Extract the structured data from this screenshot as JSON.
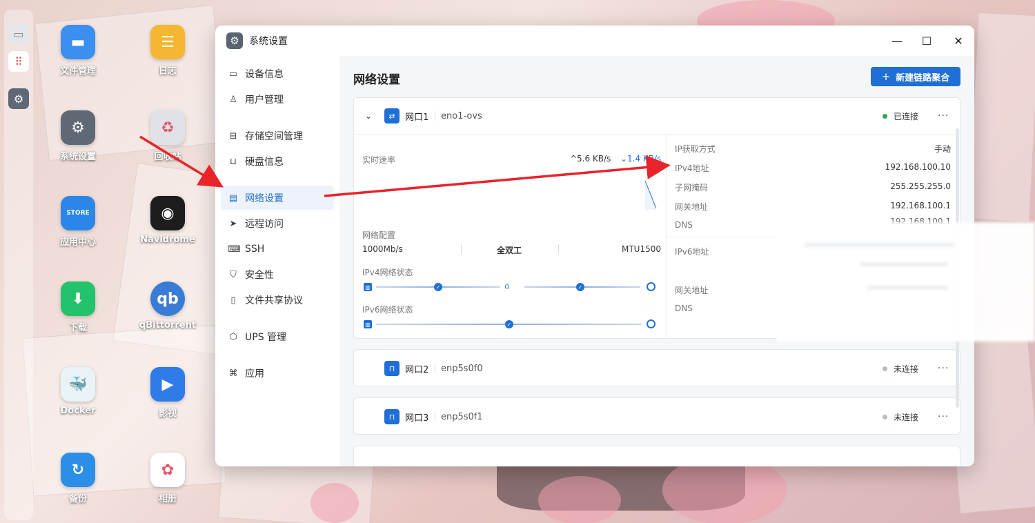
{
  "colors": {
    "accent": "#1f6fd6",
    "connected": "#2fa84f",
    "disconnected": "#b5bcc6",
    "arrow": "#e8232a"
  },
  "desktop": {
    "icons": [
      {
        "label": "文件管理",
        "icon": "folder-icon",
        "color": "#3b8ff0"
      },
      {
        "label": "日志",
        "icon": "log-icon",
        "color": "#f5b731"
      },
      {
        "label": "系统设置",
        "icon": "settings-icon",
        "color": "#5f6875"
      },
      {
        "label": "回收站",
        "icon": "recycle-icon",
        "color": "#dfe3e8"
      },
      {
        "label": "应用中心",
        "icon": "store-icon",
        "color": "#2b86e8"
      },
      {
        "label": "Navidrome",
        "icon": "vinyl-icon",
        "color": "#1d1d1d"
      },
      {
        "label": "下载",
        "icon": "download-icon",
        "color": "#22c36a"
      },
      {
        "label": "qBittorrent",
        "icon": "qbittorrent-icon",
        "color": "#3a7bd5"
      },
      {
        "label": "Docker",
        "icon": "docker-icon",
        "color": "#e9f2f7"
      },
      {
        "label": "影视",
        "icon": "video-icon",
        "color": "#2f7be8"
      },
      {
        "label": "备份",
        "icon": "backup-icon",
        "color": "#2b8fe8"
      },
      {
        "label": "相册",
        "icon": "photos-icon",
        "color": "#ffffff"
      }
    ],
    "store_text": "STORE",
    "qb_text": "qb"
  },
  "window": {
    "title": "系统设置",
    "controls": {
      "minimize": "—",
      "maximize": "☐",
      "close": "✕"
    }
  },
  "sidebar": {
    "items": [
      {
        "label": "设备信息",
        "icon": "device-info-icon",
        "glyph": "▭"
      },
      {
        "label": "用户管理",
        "icon": "user-icon",
        "glyph": "♙"
      },
      {
        "label": "存储空间管理",
        "icon": "storage-icon",
        "glyph": "⊟"
      },
      {
        "label": "硬盘信息",
        "icon": "disk-icon",
        "glyph": "⊔"
      },
      {
        "label": "网络设置",
        "icon": "network-icon",
        "glyph": "▤"
      },
      {
        "label": "远程访问",
        "icon": "remote-access-icon",
        "glyph": "➤"
      },
      {
        "label": "SSH",
        "icon": "ssh-icon",
        "glyph": "⌨"
      },
      {
        "label": "安全性",
        "icon": "shield-icon",
        "glyph": "⛉"
      },
      {
        "label": "文件共享协议",
        "icon": "file-share-icon",
        "glyph": "▯"
      },
      {
        "label": "UPS 管理",
        "icon": "ups-icon",
        "glyph": "⬡"
      },
      {
        "label": "应用",
        "icon": "apps-icon",
        "glyph": "⌘"
      }
    ],
    "active_label": "网络设置"
  },
  "main": {
    "title": "网络设置",
    "new_button": "新建链路聚合",
    "ports": [
      {
        "name": "网口1",
        "device": "eno1-ovs",
        "status": "已连接",
        "expanded": true,
        "speed_label": "实时速率",
        "upload": "5.6 KB/s",
        "download": "1.4 KB/s",
        "config_label": "网络配置",
        "link_speed": "1000Mb/s",
        "duplex": "全双工",
        "mtu": "MTU1500",
        "ipv4_status_label": "IPv4网络状态",
        "ipv6_status_label": "IPv6网络状态",
        "ip_method_label": "IP获取方式",
        "ip_method": "手动",
        "ipv4_label": "IPv4地址",
        "ipv4": "192.168.100.10",
        "mask_label": "子网掩码",
        "mask": "255.255.255.0",
        "gateway_label": "网关地址",
        "gateway": "192.168.100.1",
        "dns_label": "DNS",
        "dns_partial": "192.168.100.1",
        "ipv6_label": "IPv6地址",
        "gateway6_label": "网关地址",
        "dns6_label": "DNS"
      },
      {
        "name": "网口2",
        "device": "enp5s0f0",
        "status": "未连接",
        "expanded": false
      },
      {
        "name": "网口3",
        "device": "enp5s0f1",
        "status": "未连接",
        "expanded": false
      }
    ]
  }
}
